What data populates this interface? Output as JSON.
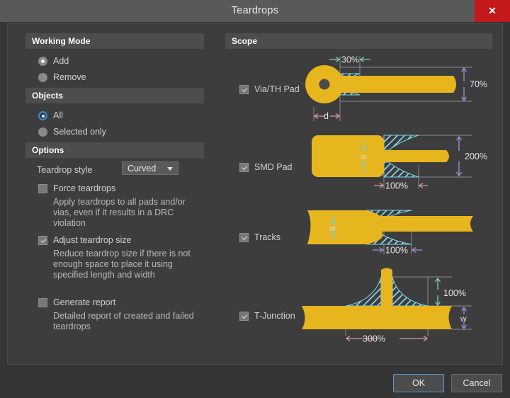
{
  "window": {
    "title": "Teardrops",
    "close_icon": "close-icon",
    "close_label": "✕"
  },
  "left": {
    "working_mode": {
      "header": "Working Mode",
      "options": [
        {
          "label": "Add",
          "selected": true
        },
        {
          "label": "Remove",
          "selected": false
        }
      ]
    },
    "objects": {
      "header": "Objects",
      "options": [
        {
          "label": "All",
          "selected": true,
          "focused": true
        },
        {
          "label": "Selected only",
          "selected": false,
          "focused": false
        }
      ]
    },
    "options": {
      "header": "Options",
      "teardrop_style_label": "Teardrop style",
      "teardrop_style_value": "Curved",
      "teardrop_style_arrow": "chevron-down-icon",
      "checks": [
        {
          "label": "Force teardrops",
          "checked": false,
          "description": "Apply teardrops to all pads and/or vias, even if it results in a DRC violation"
        },
        {
          "label": "Adjust teardrop size",
          "checked": true,
          "description": "Reduce teardrop size if there is not enough space to place it using specified length and width"
        },
        {
          "label": "Generate report",
          "checked": false,
          "description": "Detailed report of created and failed teardrops"
        }
      ]
    }
  },
  "scope": {
    "header": "Scope",
    "items": [
      {
        "label": "Via/TH Pad",
        "checked": true,
        "dimensions": {
          "length": "30%",
          "width": "70%",
          "diameter": "d"
        }
      },
      {
        "label": "SMD Pad",
        "checked": true,
        "dimensions": {
          "length": "100%",
          "width": "200%",
          "pad_width": "w"
        }
      },
      {
        "label": "Tracks",
        "checked": true,
        "dimensions": {
          "length": "100%",
          "track_width": "w"
        }
      },
      {
        "label": "T-Junction",
        "checked": true,
        "dimensions": {
          "height": "100%",
          "length": "300%",
          "track_width": "w"
        }
      }
    ]
  },
  "footer": {
    "ok_label": "OK",
    "cancel_label": "Cancel"
  },
  "colors": {
    "copper": "#e7b51e",
    "teardrop_hatch": "#7fd8f0",
    "accent_blue": "#4f9ede",
    "close_red": "#c3191b",
    "dim_green": "#7fd0b4",
    "dim_purple": "#9a93d6",
    "dim_pink": "#dd9aa4"
  }
}
